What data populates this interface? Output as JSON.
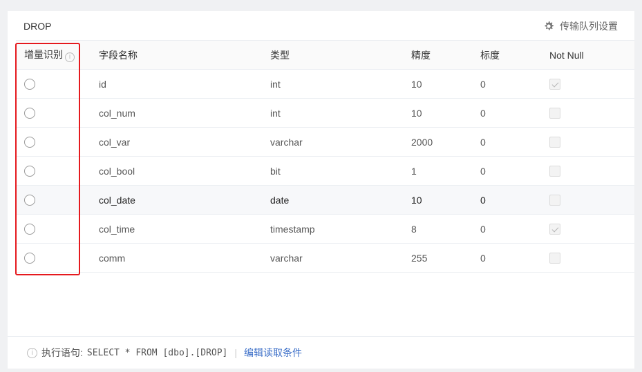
{
  "card": {
    "title": "DROP",
    "settings_label": "传输队列设置"
  },
  "table": {
    "columns": [
      "增量识别",
      "字段名称",
      "类型",
      "精度",
      "标度",
      "Not Null"
    ],
    "info_icon": "i",
    "rows": [
      {
        "name": "id",
        "type": "int",
        "precision": "10",
        "scale": "0",
        "not_null": true
      },
      {
        "name": "col_num",
        "type": "int",
        "precision": "10",
        "scale": "0",
        "not_null": false
      },
      {
        "name": "col_var",
        "type": "varchar",
        "precision": "2000",
        "scale": "0",
        "not_null": false
      },
      {
        "name": "col_bool",
        "type": "bit",
        "precision": "1",
        "scale": "0",
        "not_null": false
      },
      {
        "name": "col_date",
        "type": "date",
        "precision": "10",
        "scale": "0",
        "not_null": false
      },
      {
        "name": "col_time",
        "type": "timestamp",
        "precision": "8",
        "scale": "0",
        "not_null": true
      },
      {
        "name": "comm",
        "type": "varchar",
        "precision": "255",
        "scale": "0",
        "not_null": false
      }
    ]
  },
  "footer": {
    "info_icon": "i",
    "label": "执行语句:",
    "sql": "SELECT * FROM [dbo].[DROP]",
    "separator": "|",
    "edit_link": "编辑读取条件"
  },
  "colors": {
    "highlight_box": "#e5191e",
    "link": "#3c6fc8"
  }
}
